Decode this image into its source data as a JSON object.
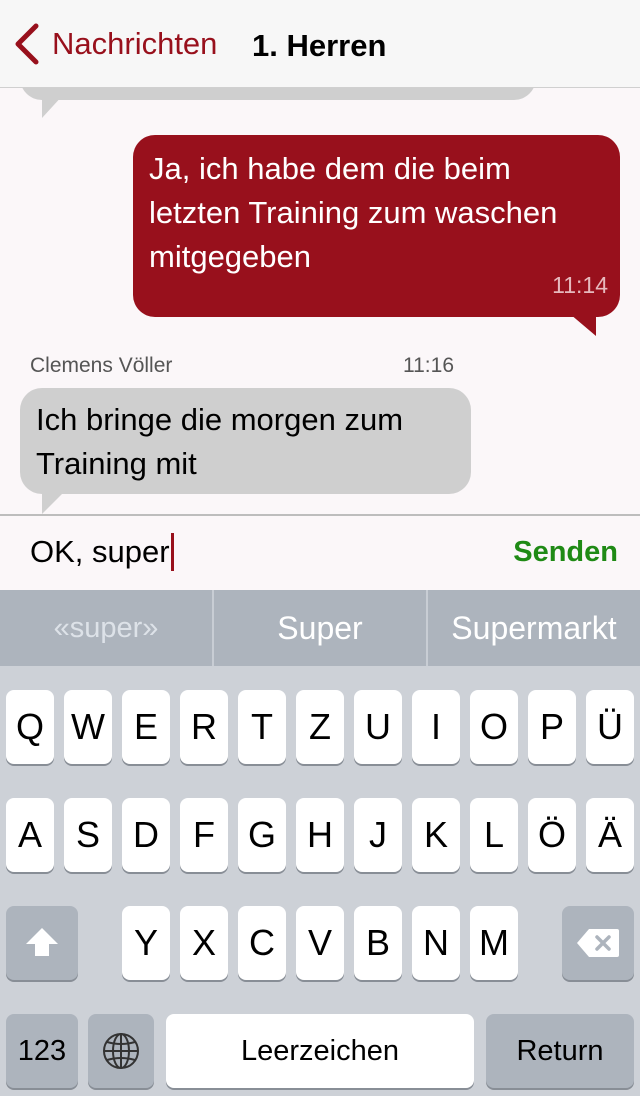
{
  "navbar": {
    "back_label": "Nachrichten",
    "title": "1. Herren"
  },
  "messages": {
    "outgoing": {
      "text": "Ja, ich habe dem die beim letzten Training zum waschen mitgegeben",
      "time": "11:14"
    },
    "incoming": {
      "sender": "Clemens Völler",
      "time": "11:16",
      "text": "Ich bringe die morgen zum Training mit"
    }
  },
  "composer": {
    "value": "OK, super",
    "send_label": "Senden"
  },
  "suggestions": [
    "«super»",
    "Super",
    "Supermarkt"
  ],
  "keyboard": {
    "row1": [
      "Q",
      "W",
      "E",
      "R",
      "T",
      "Z",
      "U",
      "I",
      "O",
      "P",
      "Ü"
    ],
    "row2": [
      "A",
      "S",
      "D",
      "F",
      "G",
      "H",
      "J",
      "K",
      "L",
      "Ö",
      "Ä"
    ],
    "row3": [
      "Y",
      "X",
      "C",
      "V",
      "B",
      "N",
      "M"
    ],
    "numbers_label": "123",
    "space_label": "Leerzeichen",
    "return_label": "Return"
  },
  "colors": {
    "accent": "#98101c",
    "send": "#1f8a15",
    "incoming_bubble": "#cfcfcf"
  }
}
